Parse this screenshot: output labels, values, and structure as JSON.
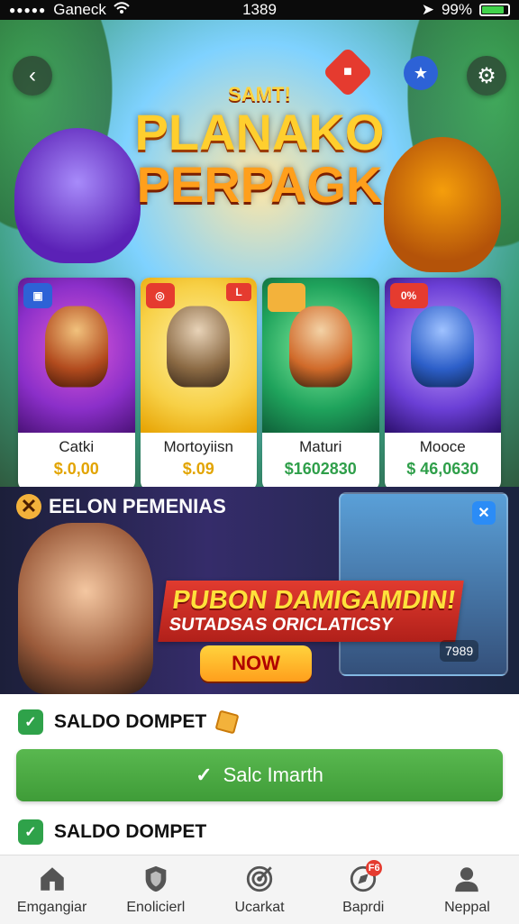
{
  "status_bar": {
    "carrier": "Ganeck",
    "time": "1389",
    "battery_percent": "99%",
    "battery_level": 0.99
  },
  "hero": {
    "subtitle": "SAMT!",
    "title_line1": "PLANAKO",
    "title_line2": "PERPAGK",
    "icons": [
      "back-icon",
      "gift-icon",
      "star-icon",
      "settings-icon"
    ]
  },
  "cards": [
    {
      "name": "Catki",
      "price": "$.0,00",
      "price_color": "#e2a400",
      "bg": "#8b2fc9"
    },
    {
      "name": "Mortoyiisn",
      "price": "$.09",
      "price_color": "#e2a400",
      "bg": "#f7d046",
      "corner_badge": "L"
    },
    {
      "name": "Maturi",
      "price": "$1602830",
      "price_color": "#2f9f4a",
      "bg": "#1fa35c"
    },
    {
      "name": "Mooce",
      "price": "$ 46,0630",
      "price_color": "#2f9f4a",
      "bg": "#6b3fd6",
      "corner_badge": "0%"
    }
  ],
  "promo": {
    "header": "EELON PEMENIAS",
    "banner_title": "PUBON DAMIGAMDIN!",
    "banner_sub": "SUTADSAS ORICLATICSY",
    "cta": "NOW",
    "counter": "7989"
  },
  "wallet": {
    "row1_label": "SALDO DOMPET",
    "button_label": "Salc Imarth",
    "row2_label": "SALDO DOMPET"
  },
  "tabs": [
    {
      "label": "Emgangiar",
      "icon": "home-icon"
    },
    {
      "label": "Enolicierl",
      "icon": "shield-icon"
    },
    {
      "label": "Ucarkat",
      "icon": "target-icon"
    },
    {
      "label": "Baprdi",
      "icon": "compass-icon",
      "badge": "F6"
    },
    {
      "label": "Neppal",
      "icon": "profile-icon"
    }
  ]
}
